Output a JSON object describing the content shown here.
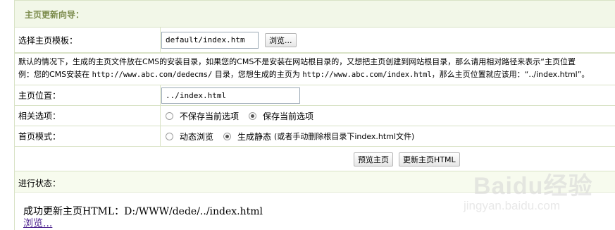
{
  "header": {
    "title": "主页更新向导："
  },
  "template_row": {
    "label": "选择主页模板：",
    "value": "default/index.htm",
    "browse_label": "浏览..."
  },
  "note": {
    "line1": "默认的情况下，生成的主页文件放在CMS的安装目录，如果您的CMS不是安装在网站根目录的，又想把主页创建到网站根目录，那么请用相对路径来表示“主页位置",
    "line2_prefix": "例：您的CMS安装在 ",
    "line2_url1": "http://www.abc.com/dedecms/",
    "line2_mid": " 目录，您想生成的主页为 ",
    "line2_url2": "http://www.abc.com/index.html",
    "line2_suffix": "，那么主页位置就应该用：“../index.html”。"
  },
  "location_row": {
    "label": "主页位置：",
    "value": "../index.html"
  },
  "options_row": {
    "label": "相关选项：",
    "opt1": "不保存当前选项",
    "opt2": "保存当前选项",
    "selected": "opt2"
  },
  "mode_row": {
    "label": "首页模式：",
    "opt1": "动态浏览",
    "opt2": "生成静态",
    "opt2_hint": "(或者手动删除根目录下index.html文件)",
    "selected": "opt2"
  },
  "actions": {
    "preview_label": "预览主页",
    "update_label": "更新主页HTML"
  },
  "status": {
    "title": "进行状态：",
    "result": "成功更新主页HTML：D:/WWW/dede/../index.html",
    "browse_link": "浏览..."
  },
  "watermark": {
    "logo": "Baidu经验",
    "sub": "jingyan.baidu.com"
  }
}
